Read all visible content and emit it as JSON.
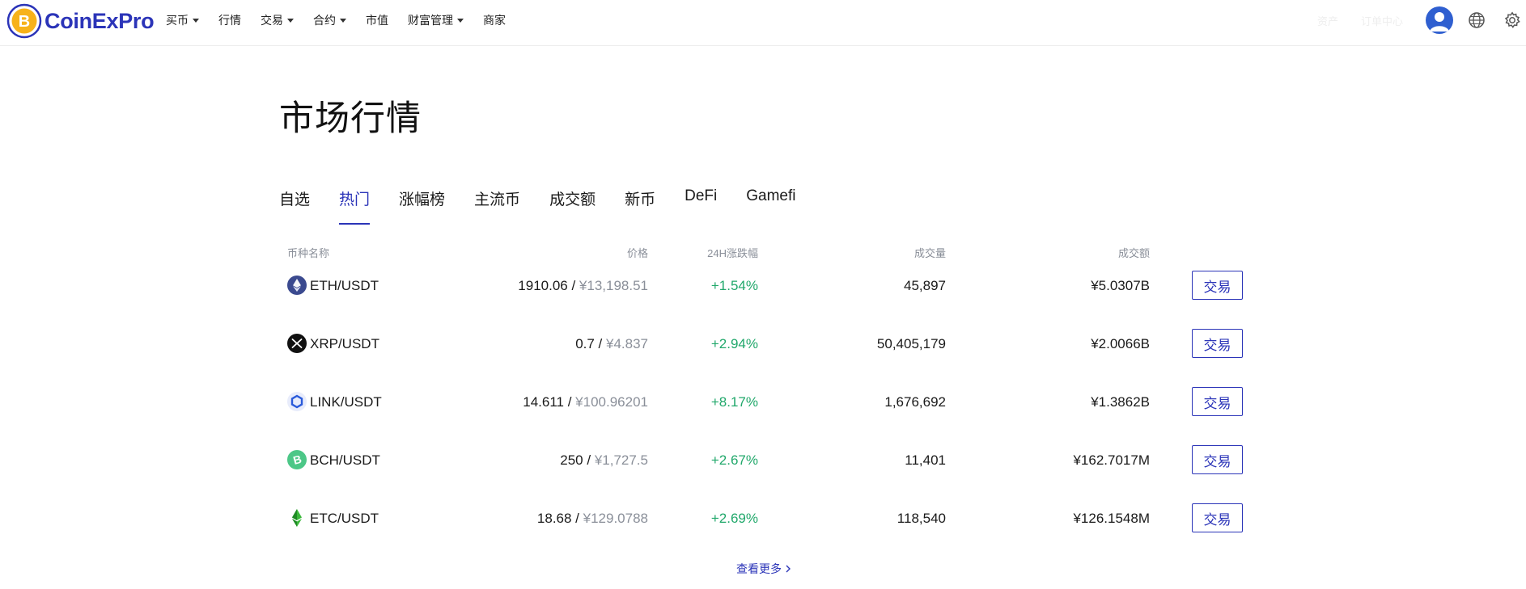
{
  "brand": {
    "name": "CoinExPro",
    "accent": "#2b34b8",
    "logo_color": "#f7b21a"
  },
  "nav": {
    "items": [
      {
        "label": "买币",
        "dropdown": true
      },
      {
        "label": "行情",
        "dropdown": false
      },
      {
        "label": "交易",
        "dropdown": true
      },
      {
        "label": "合约",
        "dropdown": true
      },
      {
        "label": "市值",
        "dropdown": false
      },
      {
        "label": "财富管理",
        "dropdown": true
      },
      {
        "label": "商家",
        "dropdown": false
      }
    ],
    "right": {
      "faint_1": "资产",
      "faint_2": "订单中心",
      "avatar_icon": "user-avatar-icon",
      "language_icon": "globe-icon",
      "settings_icon": "gear-icon"
    }
  },
  "page": {
    "title": "市场行情"
  },
  "tabs": [
    {
      "label": "自选",
      "active": false
    },
    {
      "label": "热门",
      "active": true
    },
    {
      "label": "涨幅榜",
      "active": false
    },
    {
      "label": "主流币",
      "active": false
    },
    {
      "label": "成交额",
      "active": false
    },
    {
      "label": "新币",
      "active": false
    },
    {
      "label": "DeFi",
      "active": false
    },
    {
      "label": "Gamefi",
      "active": false
    }
  ],
  "table": {
    "headers": {
      "name": "币种名称",
      "price": "价格",
      "change": "24H涨跌幅",
      "volume": "成交量",
      "turnover": "成交额"
    },
    "rows": [
      {
        "icon": "eth-icon",
        "pair": "ETH/USDT",
        "price": "1910.06",
        "price_sep": " / ",
        "price_cny": "¥13,198.51",
        "change": "+1.54%",
        "volume": "45,897",
        "turnover": "¥5.0307B",
        "action": "交易"
      },
      {
        "icon": "xrp-icon",
        "pair": "XRP/USDT",
        "price": "0.7",
        "price_sep": " / ",
        "price_cny": "¥4.837",
        "change": "+2.94%",
        "volume": "50,405,179",
        "turnover": "¥2.0066B",
        "action": "交易"
      },
      {
        "icon": "link-icon",
        "pair": "LINK/USDT",
        "price": "14.611",
        "price_sep": " / ",
        "price_cny": "¥100.96201",
        "change": "+8.17%",
        "volume": "1,676,692",
        "turnover": "¥1.3862B",
        "action": "交易"
      },
      {
        "icon": "bch-icon",
        "pair": "BCH/USDT",
        "price": "250",
        "price_sep": " / ",
        "price_cny": "¥1,727.5",
        "change": "+2.67%",
        "volume": "11,401",
        "turnover": "¥162.7017M",
        "action": "交易"
      },
      {
        "icon": "etc-icon",
        "pair": "ETC/USDT",
        "price": "18.68",
        "price_sep": " / ",
        "price_cny": "¥129.0788",
        "change": "+2.69%",
        "volume": "118,540",
        "turnover": "¥126.1548M",
        "action": "交易"
      }
    ]
  },
  "more": {
    "label": "查看更多"
  },
  "colors": {
    "up": "#21a86b",
    "muted": "#8a8f99"
  }
}
